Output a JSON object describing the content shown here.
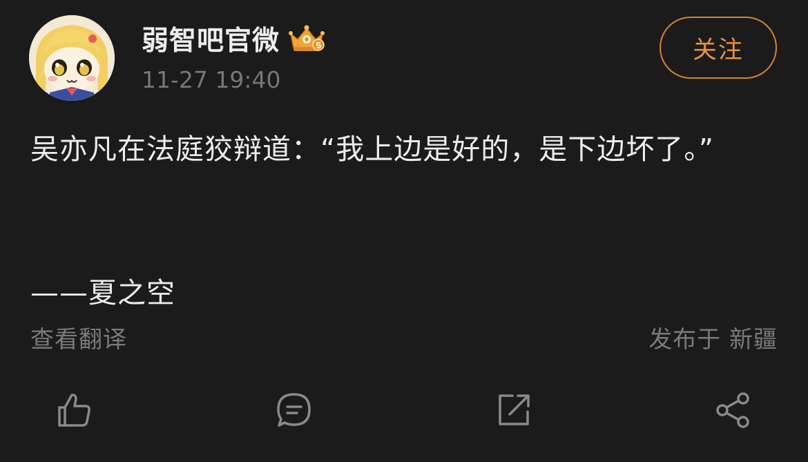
{
  "header": {
    "username": "弱智吧官微",
    "timestamp": "11-27 19:40",
    "badge_icon": "crown-badge-icon",
    "avatar_icon": "cartoon-girl-avatar"
  },
  "follow_button": {
    "label": "关注",
    "color": "#e8913a"
  },
  "post": {
    "text": "吴亦凡在法庭狡辩道：“我上边是好的，是下边坏了。”",
    "signature": "——夏之空"
  },
  "footer": {
    "translate_label": "查看翻译",
    "location_label": "发布于 新疆"
  },
  "actions": [
    {
      "name": "like",
      "icon": "thumbs-up-icon"
    },
    {
      "name": "comment",
      "icon": "comment-icon"
    },
    {
      "name": "repost",
      "icon": "repost-icon"
    },
    {
      "name": "share",
      "icon": "share-icon"
    }
  ],
  "colors": {
    "background": "#1b1b1b",
    "text": "#ececec",
    "muted": "#777777",
    "accent": "#e8913a"
  }
}
